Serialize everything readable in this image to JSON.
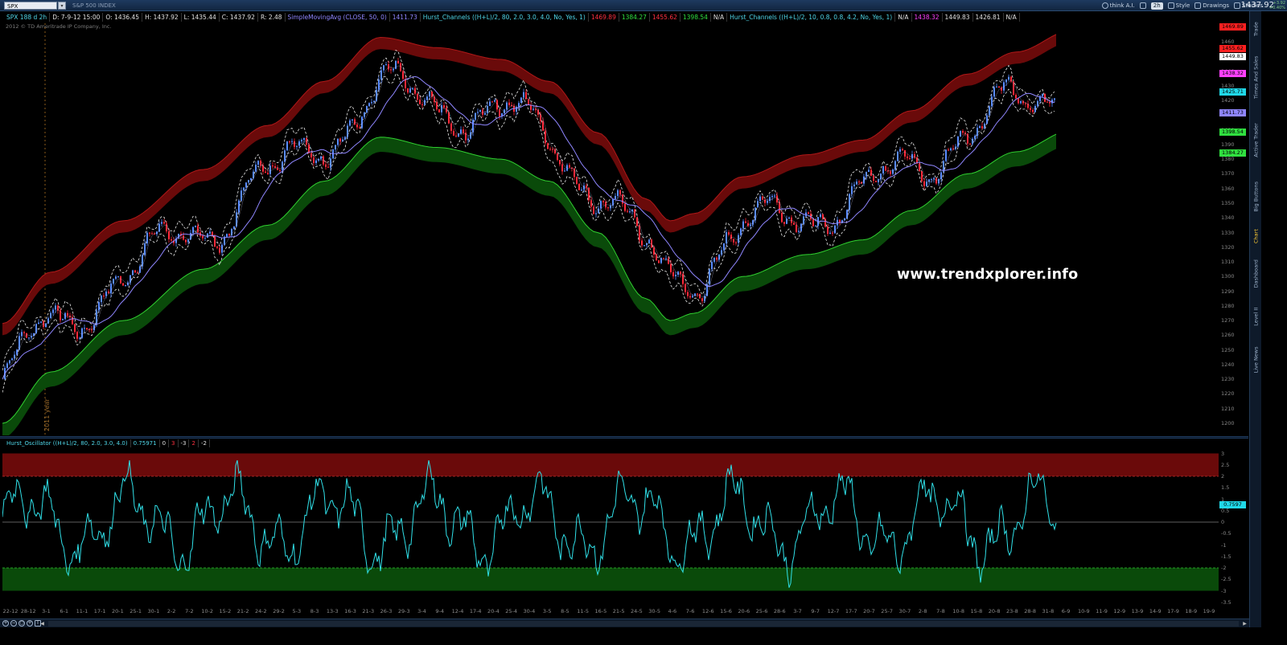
{
  "topbar": {
    "symbol": "SPX",
    "symbol_dropdown": "▾",
    "index_name": "S&P 500 INDEX",
    "buttons": [
      {
        "label": "think A.I.",
        "icon": "gear-icon"
      },
      {
        "label": "",
        "icon": "wrench-icon"
      },
      {
        "label": "2h",
        "icon": "timeframe"
      },
      {
        "label": "Style",
        "icon": "style-icon"
      },
      {
        "label": "Drawings",
        "icon": "drawing-icon"
      },
      {
        "label": "Studies",
        "icon": "studies-icon"
      }
    ],
    "last_price": "1437.92",
    "change_line1": "+3.92",
    "change_line2": "+0.40%"
  },
  "infobar": {
    "ticker": "SPX 188 d 2h",
    "date": "D: 7-9-12 15:00",
    "open": "O: 1436.45",
    "high": "H: 1437.92",
    "low": "L: 1435.44",
    "close": "C: 1437.92",
    "range": "R: 2.48",
    "sma_label": "SimpleMovingAvg (CLOSE, 50, 0)",
    "sma_value": "1411.73",
    "hc1_label": "Hurst_Channels ((H+L)/2, 80, 2.0, 3.0, 4.0, No, Yes, 1)",
    "hc1_v1": "1469.89",
    "hc1_v2": "1384.27",
    "hc1_v3": "1455.62",
    "hc1_v4": "1398.54",
    "hc1_na": "N/A",
    "hc2_label": "Hurst_Channels ((H+L)/2, 10, 0.8, 0.8, 4.2, No, Yes, 1)",
    "hc2_na1": "N/A",
    "hc2_v1": "1438.32",
    "hc2_v2": "1449.83",
    "hc2_v3": "1426.81",
    "hc2_na2": "N/A"
  },
  "copyright": "2012 © TD Ameritrade IP Company, Inc.",
  "watermark": "www.trendxplorer.info",
  "year_marker": "2011 year",
  "price_axis": {
    "ticks": [
      1200,
      1210,
      1220,
      1230,
      1240,
      1250,
      1260,
      1270,
      1280,
      1290,
      1300,
      1310,
      1320,
      1330,
      1340,
      1350,
      1360,
      1370,
      1380,
      1390,
      1400,
      1410,
      1420,
      1430,
      1440,
      1450,
      1460
    ],
    "tags": [
      {
        "value": "1469.89",
        "price": 1469.89,
        "color": "#ff2020"
      },
      {
        "value": "1455.62",
        "price": 1455.62,
        "color": "#ff2020"
      },
      {
        "value": "1449.83",
        "price": 1449.83,
        "color": "#ffffff"
      },
      {
        "value": "1438.32",
        "price": 1438.32,
        "color": "#ff40ff"
      },
      {
        "value": "1425.71",
        "price": 1425.71,
        "color": "#20d8e8"
      },
      {
        "value": "1411.73",
        "price": 1411.73,
        "color": "#8f86ff"
      },
      {
        "value": "1398.54",
        "price": 1398.54,
        "color": "#30e040"
      },
      {
        "value": "1384.27",
        "price": 1384.27,
        "color": "#30e040"
      }
    ]
  },
  "oscillator": {
    "label": "Hurst_Oscillator ((H+L)/2, 80, 2.0, 3.0, 4.0)",
    "value": "0.75971",
    "levels": [
      "0",
      "3",
      "-3",
      "2",
      "-2"
    ],
    "ticks": [
      "3",
      "2.5",
      "2",
      "1.5",
      "1",
      "0.5",
      "0",
      "-0.5",
      "-1",
      "-1.5",
      "-2",
      "-2.5",
      "-3",
      "-3.5"
    ],
    "current_tag": "0.7597"
  },
  "date_axis": [
    "22-12",
    "28-12",
    "3-1",
    "6-1",
    "11-1",
    "17-1",
    "20-1",
    "25-1",
    "30-1",
    "2-2",
    "7-2",
    "10-2",
    "15-2",
    "21-2",
    "24-2",
    "29-2",
    "5-3",
    "8-3",
    "13-3",
    "16-3",
    "21-3",
    "26-3",
    "29-3",
    "3-4",
    "9-4",
    "12-4",
    "17-4",
    "20-4",
    "25-4",
    "30-4",
    "3-5",
    "8-5",
    "11-5",
    "16-5",
    "21-5",
    "24-5",
    "30-5",
    "4-6",
    "7-6",
    "12-6",
    "15-6",
    "20-6",
    "25-6",
    "28-6",
    "3-7",
    "9-7",
    "12-7",
    "17-7",
    "20-7",
    "25-7",
    "30-7",
    "2-8",
    "7-8",
    "10-8",
    "15-8",
    "20-8",
    "23-8",
    "28-8",
    "31-8",
    "6-9",
    "10-9",
    "11-9",
    "12-9",
    "13-9",
    "14-9",
    "17-9",
    "18-9",
    "19-9"
  ],
  "sidebar_tabs": [
    "Trade",
    "Times And Sales",
    "Active Trader",
    "Big Buttons",
    "Chart",
    "Dashboard",
    "Level II",
    "Live News"
  ],
  "active_tab": "Chart",
  "bottom_icons": [
    "zoom-in-icon",
    "zoom-out-icon",
    "magnifier-icon",
    "crosshair-icon",
    "text-icon"
  ]
}
